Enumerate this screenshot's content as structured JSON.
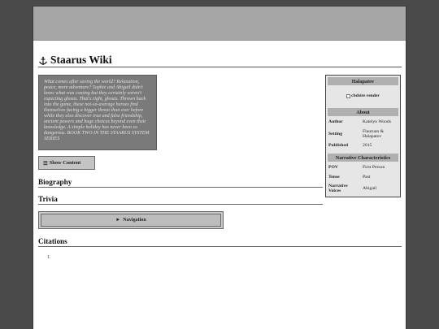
{
  "wiki": {
    "title": "Staarus Wiki"
  },
  "synopsis": "What comes after saving the world? Relaxation, peace, more adventure? Sophie and Abigail didn't know what was coming but they certainly weren't expecting ghosts. That's right, ghosts. Thrown back into the game, these not-so-average heroes find themselves facing a bigger threat than ever before while they also discover true and false friendship, ancient powers and huge choices beyond even their knowledge. A simple holiday has never been so dangerous. BOOK TWO IN THE STAARUS SYSTEM SERIES",
  "show_content": {
    "icon": "☰",
    "label": "Show Content"
  },
  "sections": {
    "biography": "Biography",
    "trivia": "Trivia",
    "citations": "Citations"
  },
  "navigation": {
    "icon": "►",
    "label": "Navigation"
  },
  "citations": {
    "first_marker": "1."
  },
  "infobox": {
    "title": "Halapatov",
    "image_alt": "cbdsire render",
    "about_header": "About",
    "narrative_header": "Narrative Characteristics",
    "about": [
      {
        "key": "Author",
        "value": "Katelyn Woods"
      },
      {
        "key": "Setting",
        "value": "Flauruan & Halapatov"
      },
      {
        "key": "Published",
        "value": "2015"
      }
    ],
    "narrative": [
      {
        "key": "POV",
        "value": "First Person"
      },
      {
        "key": "Tense",
        "value": "Past"
      },
      {
        "key": "Narrative Voices",
        "value": "Abigail"
      }
    ]
  },
  "colors": {
    "background": "#4a4a4a",
    "topbar": "#a6a6a6",
    "synopsis_bg": "#7a7a7a",
    "infobox_header": "#b0b0b0"
  }
}
